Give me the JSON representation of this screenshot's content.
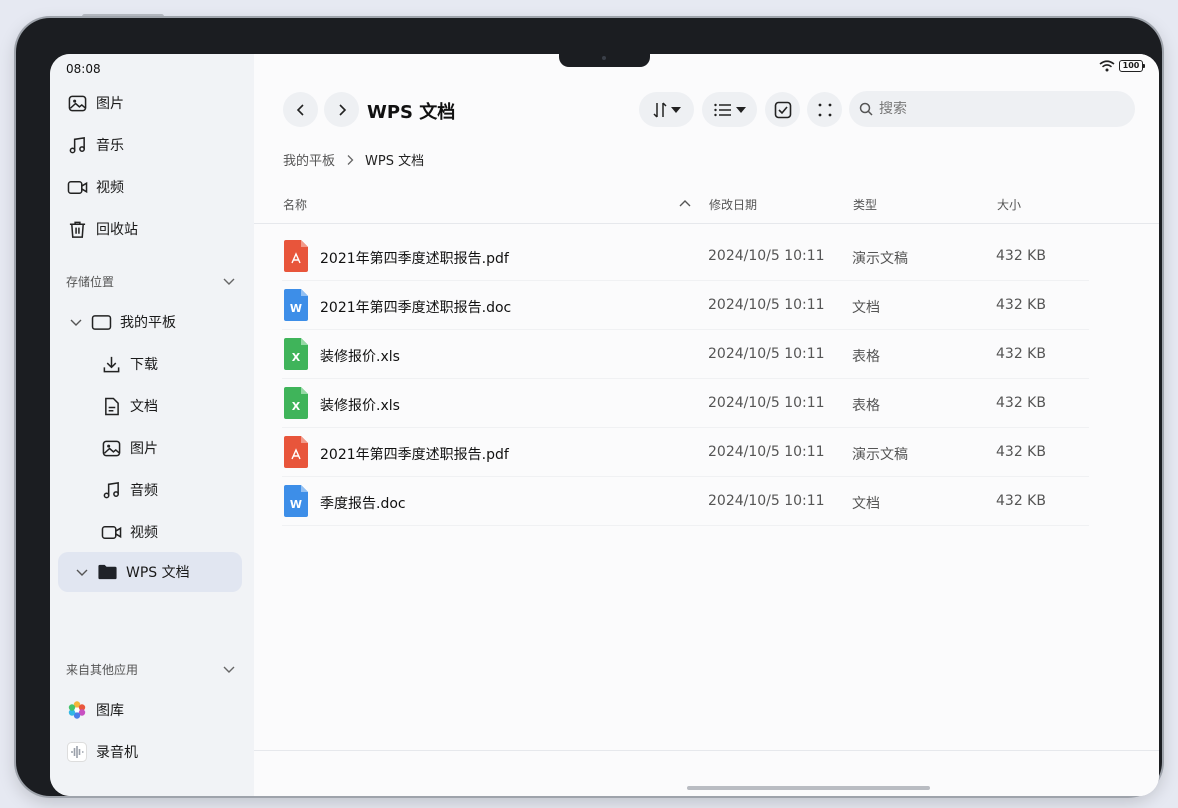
{
  "status": {
    "time": "08:08",
    "battery": "100"
  },
  "sidebar": {
    "quick": [
      {
        "label": "图片",
        "icon": "image-icon"
      },
      {
        "label": "音乐",
        "icon": "music-icon"
      },
      {
        "label": "视频",
        "icon": "video-icon"
      },
      {
        "label": "回收站",
        "icon": "trash-icon"
      }
    ],
    "storage_header": "存储位置",
    "device": "我的平板",
    "device_children": [
      {
        "label": "下载",
        "icon": "download-icon"
      },
      {
        "label": "文档",
        "icon": "document-icon"
      },
      {
        "label": "图片",
        "icon": "image-icon"
      },
      {
        "label": "音频",
        "icon": "music-icon"
      },
      {
        "label": "视频",
        "icon": "video-icon"
      }
    ],
    "selected_folder": "WPS 文档",
    "other_apps_header": "来自其他应用",
    "apps": [
      {
        "label": "图库",
        "icon": "gallery-icon"
      },
      {
        "label": "录音机",
        "icon": "recorder-icon"
      }
    ]
  },
  "header": {
    "title": "WPS 文档",
    "search_placeholder": "搜索"
  },
  "breadcrumb": {
    "root": "我的平板",
    "current": "WPS 文档"
  },
  "table": {
    "columns": {
      "name": "名称",
      "modified": "修改日期",
      "type": "类型",
      "size": "大小"
    },
    "rows": [
      {
        "name": "2021年第四季度述职报告.pdf",
        "modified": "2024/10/5 10:11",
        "type": "演示文稿",
        "size": "432 KB",
        "icon": "pdf-file-icon"
      },
      {
        "name": "2021年第四季度述职报告.doc",
        "modified": "2024/10/5 10:11",
        "type": "文档",
        "size": "432 KB",
        "icon": "word-file-icon"
      },
      {
        "name": "装修报价.xls",
        "modified": "2024/10/5 10:11",
        "type": "表格",
        "size": "432 KB",
        "icon": "excel-file-icon"
      },
      {
        "name": "装修报价.xls",
        "modified": "2024/10/5 10:11",
        "type": "表格",
        "size": "432 KB",
        "icon": "excel-file-icon"
      },
      {
        "name": "2021年第四季度述职报告.pdf",
        "modified": "2024/10/5 10:11",
        "type": "演示文稿",
        "size": "432 KB",
        "icon": "pdf-file-icon"
      },
      {
        "name": "季度报告.doc",
        "modified": "2024/10/5 10:11",
        "type": "文档",
        "size": "432 KB",
        "icon": "word-file-icon"
      }
    ]
  },
  "colors": {
    "pdf": "#e8553b",
    "word": "#3d8ee8",
    "excel": "#3fb45a",
    "selected_bg": "#e1e6f1"
  }
}
